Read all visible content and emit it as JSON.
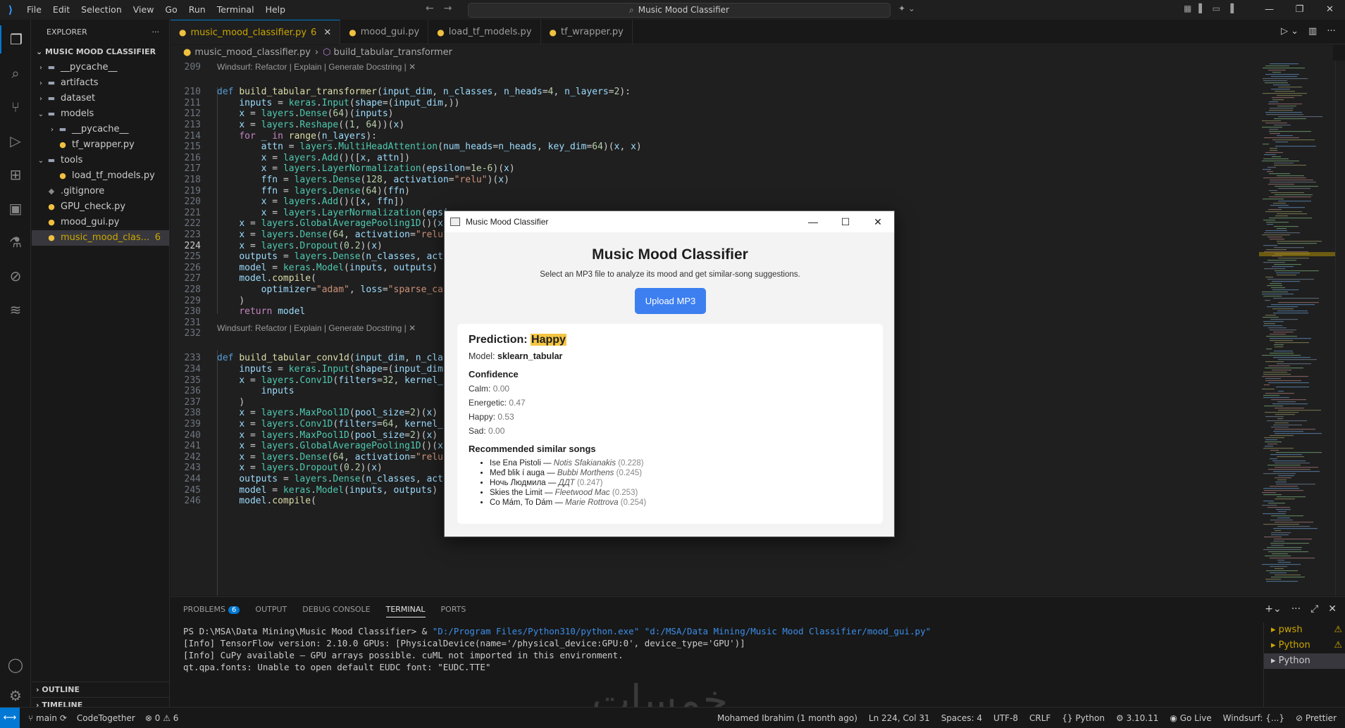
{
  "titlebar": {
    "menu": [
      "File",
      "Edit",
      "Selection",
      "View",
      "Go",
      "Run",
      "Terminal",
      "Help"
    ],
    "search_text": "Music Mood Classifier"
  },
  "sidebar": {
    "title": "EXPLORER",
    "root": "MUSIC MOOD CLASSIFIER",
    "items": [
      {
        "label": "__pycache__",
        "depth": 1,
        "kind": "folder",
        "twisty": "›"
      },
      {
        "label": "artifacts",
        "depth": 1,
        "kind": "folder",
        "twisty": "›"
      },
      {
        "label": "dataset",
        "depth": 1,
        "kind": "folder",
        "twisty": "›"
      },
      {
        "label": "models",
        "depth": 1,
        "kind": "folder",
        "twisty": "⌄"
      },
      {
        "label": "__pycache__",
        "depth": 2,
        "kind": "folder",
        "twisty": "›"
      },
      {
        "label": "tf_wrapper.py",
        "depth": 2,
        "kind": "py",
        "twisty": ""
      },
      {
        "label": "tools",
        "depth": 1,
        "kind": "folder",
        "twisty": "⌄"
      },
      {
        "label": "load_tf_models.py",
        "depth": 2,
        "kind": "py",
        "twisty": ""
      },
      {
        "label": ".gitignore",
        "depth": 1,
        "kind": "git",
        "twisty": ""
      },
      {
        "label": "GPU_check.py",
        "depth": 1,
        "kind": "py",
        "twisty": ""
      },
      {
        "label": "mood_gui.py",
        "depth": 1,
        "kind": "py",
        "twisty": ""
      },
      {
        "label": "music_mood_clas...",
        "depth": 1,
        "kind": "py",
        "twisty": "",
        "badge": "6",
        "selected": true
      }
    ],
    "outline": "OUTLINE",
    "timeline": "TIMELINE"
  },
  "tabs": [
    {
      "label": "music_mood_classifier.py",
      "count": "6",
      "active": true
    },
    {
      "label": "mood_gui.py"
    },
    {
      "label": "load_tf_models.py"
    },
    {
      "label": "tf_wrapper.py"
    }
  ],
  "breadcrumb": {
    "file": "music_mood_classifier.py",
    "symbol": "build_tabular_transformer"
  },
  "editor": {
    "lens1": "Windsurf: Refactor | Explain | Generate Docstring | ✕",
    "lens2": "Windsurf: Refactor | Explain | Generate Docstring | ✕",
    "lines": [
      {
        "n": "209",
        "c": ""
      },
      {
        "n": "210",
        "c": "def build_tabular_transformer(input_dim, n_classes, n_heads=4, n_layers=2):"
      },
      {
        "n": "211",
        "c": "    inputs = keras.Input(shape=(input_dim,))"
      },
      {
        "n": "212",
        "c": "    x = layers.Dense(64)(inputs)"
      },
      {
        "n": "213",
        "c": "    x = layers.Reshape((1, 64))(x)"
      },
      {
        "n": "214",
        "c": "    for _ in range(n_layers):"
      },
      {
        "n": "215",
        "c": "        attn = layers.MultiHeadAttention(num_heads=n_heads, key_dim=64)(x, x)"
      },
      {
        "n": "216",
        "c": "        x = layers.Add()([x, attn])"
      },
      {
        "n": "217",
        "c": "        x = layers.LayerNormalization(epsilon=1e-6)(x)"
      },
      {
        "n": "218",
        "c": "        ffn = layers.Dense(128, activation=\"relu\")(x)"
      },
      {
        "n": "219",
        "c": "        ffn = layers.Dense(64)(ffn)"
      },
      {
        "n": "220",
        "c": "        x = layers.Add()([x, ffn])"
      },
      {
        "n": "221",
        "c": "        x = layers.LayerNormalization(epsi"
      },
      {
        "n": "222",
        "c": "    x = layers.GlobalAveragePooling1D()(x)"
      },
      {
        "n": "223",
        "c": "    x = layers.Dense(64, activation=\"relu\""
      },
      {
        "n": "224",
        "c": "    x = layers.Dropout(0.2)(x)",
        "cur": true
      },
      {
        "n": "225",
        "c": "    outputs = layers.Dense(n_classes, acti"
      },
      {
        "n": "226",
        "c": "    model = keras.Model(inputs, outputs)"
      },
      {
        "n": "227",
        "c": "    model.compile("
      },
      {
        "n": "228",
        "c": "        optimizer=\"adam\", loss=\"sparse_cat"
      },
      {
        "n": "229",
        "c": "    )"
      },
      {
        "n": "230",
        "c": "    return model"
      },
      {
        "n": "231",
        "c": ""
      },
      {
        "n": "232",
        "c": ""
      },
      {
        "n": "233",
        "c": "def build_tabular_conv1d(input_dim, n_clas"
      },
      {
        "n": "234",
        "c": "    inputs = keras.Input(shape=(input_dim,"
      },
      {
        "n": "235",
        "c": "    x = layers.Conv1D(filters=32, kernel_s"
      },
      {
        "n": "236",
        "c": "        inputs"
      },
      {
        "n": "237",
        "c": "    )"
      },
      {
        "n": "238",
        "c": "    x = layers.MaxPool1D(pool_size=2)(x)"
      },
      {
        "n": "239",
        "c": "    x = layers.Conv1D(filters=64, kernel_s"
      },
      {
        "n": "240",
        "c": "    x = layers.MaxPool1D(pool_size=2)(x)"
      },
      {
        "n": "241",
        "c": "    x = layers.GlobalAveragePooling1D()(x)"
      },
      {
        "n": "242",
        "c": "    x = layers.Dense(64, activation=\"relu\""
      },
      {
        "n": "243",
        "c": "    x = layers.Dropout(0.2)(x)"
      },
      {
        "n": "244",
        "c": "    outputs = layers.Dense(n_classes, activation=\"softmax\")(x)"
      },
      {
        "n": "245",
        "c": "    model = keras.Model(inputs, outputs)"
      },
      {
        "n": "246",
        "c": "    model.compile("
      }
    ]
  },
  "panel": {
    "tabs": [
      "PROBLEMS",
      "OUTPUT",
      "DEBUG CONSOLE",
      "TERMINAL",
      "PORTS"
    ],
    "problems_count": "6",
    "terminal": {
      "prompt": "PS D:\\MSA\\Data Mining\\Music Mood Classifier> & ",
      "cmd_exe": "\"D:/Program Files/Python310/python.exe\"",
      "cmd_arg": " \"d:/MSA/Data Mining/Music Mood Classifier/mood_gui.py\"",
      "line2": "[Info] TensorFlow version: 2.10.0 GPUs: [PhysicalDevice(name='/physical_device:GPU:0', device_type='GPU')]",
      "line3": "[Info] CuPy available — GPU arrays possible. cuML not imported in this environment.",
      "line4": "qt.qpa.fonts: Unable to open default EUDC font: \"EUDC.TTE\""
    },
    "terminals": [
      "pwsh",
      "Python",
      "Python"
    ]
  },
  "watermark": "خمسات",
  "statusbar": {
    "branch": "main",
    "codetogether": "CodeTogether",
    "errors": "0",
    "warnings": "6",
    "blame": "Mohamed Ibrahim (1 month ago)",
    "position": "Ln 224, Col 31",
    "spaces": "Spaces: 4",
    "encoding": "UTF-8",
    "eol": "CRLF",
    "language": "Python",
    "python_version": "3.10.11",
    "golive": "Go Live",
    "windsurf": "Windsurf: {...}",
    "prettier": "Prettier"
  },
  "dialog": {
    "window_title": "Music Mood Classifier",
    "heading": "Music Mood Classifier",
    "subtitle": "Select an MP3 file to analyze its mood and get similar-song suggestions.",
    "upload_label": "Upload MP3",
    "prediction_label": "Prediction:",
    "prediction_value": "Happy",
    "model_label": "Model:",
    "model_value": "sklearn_tabular",
    "confidence_heading": "Confidence",
    "confidence": [
      {
        "label": "Calm:",
        "value": "0.00"
      },
      {
        "label": "Energetic:",
        "value": "0.47"
      },
      {
        "label": "Happy:",
        "value": "0.53"
      },
      {
        "label": "Sad:",
        "value": "0.00"
      }
    ],
    "songs_heading": "Recommended similar songs",
    "songs": [
      {
        "title": "Ise Ena Pistoli",
        "artist": "Notis Sfakianakis",
        "dist": "(0.228)"
      },
      {
        "title": "Međ blik í auga",
        "artist": "Bubbi Morthens",
        "dist": "(0.245)"
      },
      {
        "title": "Ночь Людмила",
        "artist": "ДДТ",
        "dist": "(0.247)"
      },
      {
        "title": "Skies the Limit",
        "artist": "Fleetwood Mac",
        "dist": "(0.253)"
      },
      {
        "title": "Co Mám, To Dám",
        "artist": "Marie Rottrova",
        "dist": "(0.254)"
      }
    ]
  }
}
